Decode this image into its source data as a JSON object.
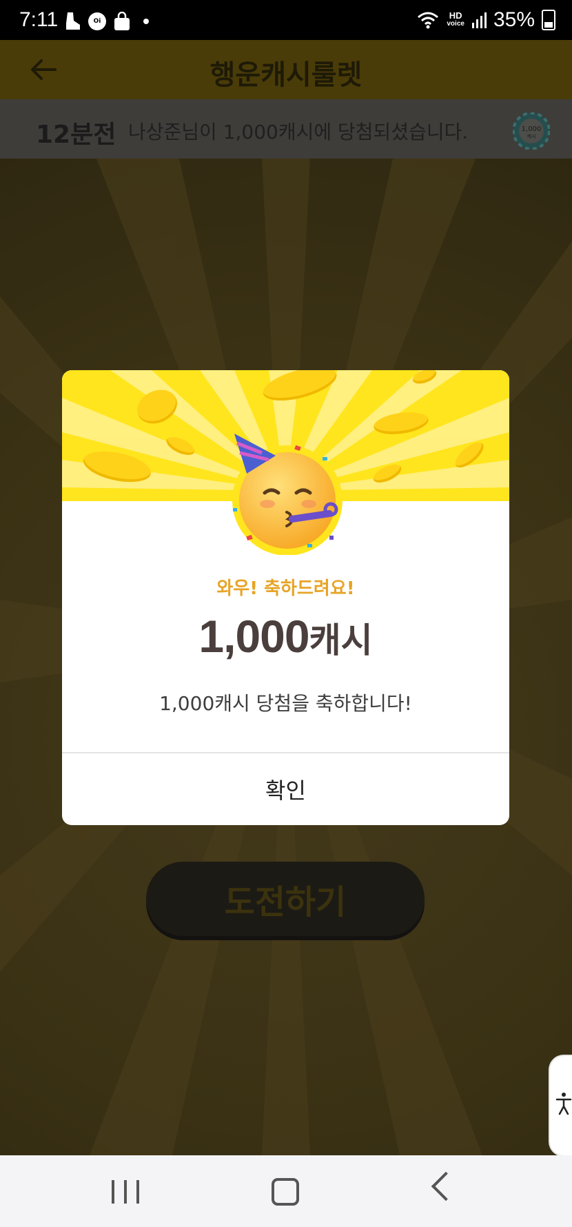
{
  "status_bar": {
    "time": "7:11",
    "left_icons": [
      "boot-icon",
      "oi-lock-icon",
      "shopping-bag-icon",
      "dot-icon"
    ],
    "hd_label_top": "HD",
    "hd_label_bottom": "voice",
    "battery": "35%"
  },
  "app_bar": {
    "title": "행운캐시룰렛",
    "back_icon": "arrow-left-icon"
  },
  "ticker": {
    "time_ago": "12분전",
    "message": "나상준님이 1,000캐시에 당첨되셨습니다.",
    "coin_label": "1,000",
    "coin_sublabel": "캐시"
  },
  "dialog": {
    "headline": "와우! 축하드려요!",
    "amount_number": "1,000",
    "amount_unit": "캐시",
    "body": "1,000캐시 당첨을 축하합니다!",
    "confirm_label": "확인",
    "emoji": "partying-face-emoji"
  },
  "challenge_button": {
    "label": "도전하기"
  },
  "accessibility_tab": {
    "icon": "accessibility-icon"
  },
  "nav_bar": {
    "items": [
      "recents-icon",
      "home-icon",
      "back-icon"
    ]
  },
  "colors": {
    "banner_yellow": "#ffe51d",
    "headline_orange": "#e7a425",
    "amount_text": "#4a3f3d",
    "overlay_bg": "#3a3114"
  }
}
